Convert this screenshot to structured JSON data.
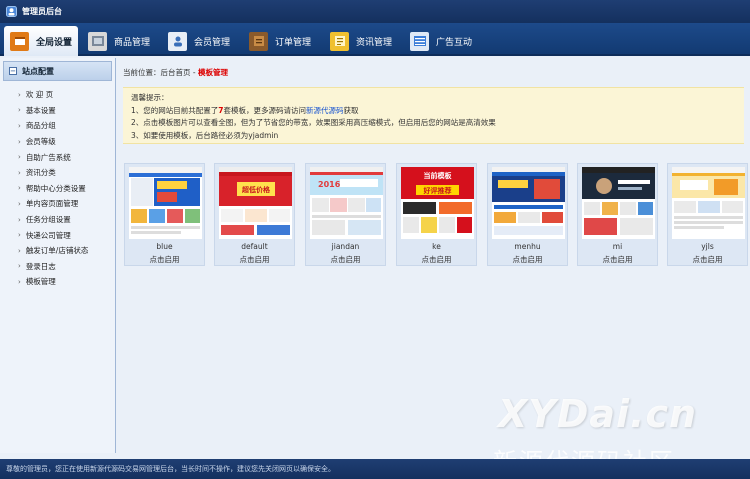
{
  "topbar": {
    "title": "管理员后台"
  },
  "nav": [
    {
      "label": "全局设置",
      "icon": "settings-tab-icon",
      "active": true
    },
    {
      "label": "商品管理",
      "icon": "goods-icon",
      "active": false
    },
    {
      "label": "会员管理",
      "icon": "member-icon",
      "active": false
    },
    {
      "label": "订单管理",
      "icon": "order-icon",
      "active": false
    },
    {
      "label": "资讯管理",
      "icon": "news-icon",
      "active": false
    },
    {
      "label": "广告互动",
      "icon": "ad-icon",
      "active": false
    }
  ],
  "sidebar": {
    "title": "站点配置",
    "items": [
      {
        "label": "欢 迎 页"
      },
      {
        "label": "基本设置"
      },
      {
        "label": "商品分组"
      },
      {
        "label": "会员等级"
      },
      {
        "label": "自助广告系统"
      },
      {
        "label": "资讯分类"
      },
      {
        "label": "帮助中心分类设置"
      },
      {
        "label": "单内容页面管理"
      },
      {
        "label": "任务分组设置"
      },
      {
        "label": "快递公司管理"
      },
      {
        "label": "触发订单/店铺状态"
      },
      {
        "label": "登录日志"
      },
      {
        "label": "模板管理"
      }
    ]
  },
  "breadcrumb": {
    "prefix": "当前位置：后台首页 - ",
    "current": "模板管理"
  },
  "tip": {
    "heading": "温馨提示：",
    "line1_a": "1、您的网站目前共配置了",
    "line1_count": "7",
    "line1_b": "套模板，更多源码请访问",
    "line1_link": "新源代源码",
    "line1_c": "获取",
    "line2": "2、点击模板图片可以查看全图，但为了节省您的带宽，效果图采用高压缩模式，但启用后您的网站是高清效果",
    "line3": "3、如要使用模板，后台路径必须为yjadmin"
  },
  "templates": [
    {
      "name": "blue",
      "action": "点击启用"
    },
    {
      "name": "default",
      "action": "点击启用"
    },
    {
      "name": "jiandan",
      "action": "点击启用"
    },
    {
      "name": "ke",
      "action": "点击启用"
    },
    {
      "name": "menhu",
      "action": "点击启用"
    },
    {
      "name": "mi",
      "action": "点击启用"
    },
    {
      "name": "yjls",
      "action": "点击启用"
    }
  ],
  "thumb_text": {
    "default_banner": "超低价格",
    "jiandan_banner": "2016",
    "ke_banner_top": "当前模板",
    "ke_banner_bottom": "好评推荐"
  },
  "footer": {
    "text": "尊敬的管理员，您正在使用新源代源码交易网管理后台，当长时间不操作，建议您先关闭网页以确保安全。"
  },
  "watermark": {
    "brand": "XYDai.cn",
    "slogan": "新源代源码社区"
  },
  "colors": {
    "topbar": "#1f3e73",
    "navbar": "#1d4a8a",
    "highlight": "#dd0000",
    "link": "#1a55d0",
    "tip_bg": "#fbf5d6"
  }
}
